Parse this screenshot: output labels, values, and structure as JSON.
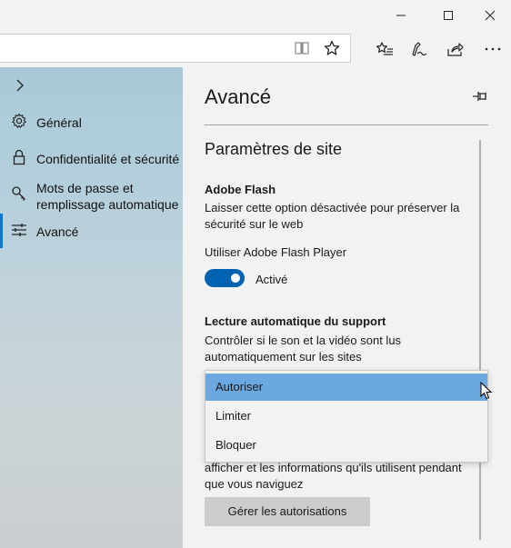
{
  "sidebar": {
    "items": [
      {
        "label": "Général",
        "icon": "gear-icon"
      },
      {
        "label": "Confidentialité et sécurité",
        "icon": "lock-icon"
      },
      {
        "label": "Mots de passe et remplissage automatique",
        "line1": "Mots de passe et",
        "line2": "remplissage automatique",
        "icon": "key-icon"
      },
      {
        "label": "Avancé",
        "icon": "sliders-icon",
        "active": true
      }
    ]
  },
  "panel": {
    "title": "Avancé",
    "section_title": "Paramètres de site",
    "flash": {
      "heading": "Adobe Flash",
      "desc_line1": "Laisser cette option désactivée pour préserver la",
      "desc_line2": "sécurité sur le web",
      "setting_label": "Utiliser Adobe Flash Player",
      "toggle_state": "Activé"
    },
    "autoplay": {
      "heading": "Lecture automatique du support",
      "desc_line1": "Contrôler si le son et la vidéo sont lus",
      "desc_line2": "automatiquement sur les sites",
      "options": [
        "Autoriser",
        "Limiter",
        "Bloquer"
      ],
      "selected": "Autoriser"
    },
    "obscured_line1": "afficher et les informations qu'ils utilisent pendant",
    "obscured_line2": "que vous naviguez",
    "manage_button": "Gérer les autorisations"
  },
  "colors": {
    "accent": "#0063b1",
    "selected_option": "#6ba7e0",
    "active_bar": "#0078d7"
  }
}
